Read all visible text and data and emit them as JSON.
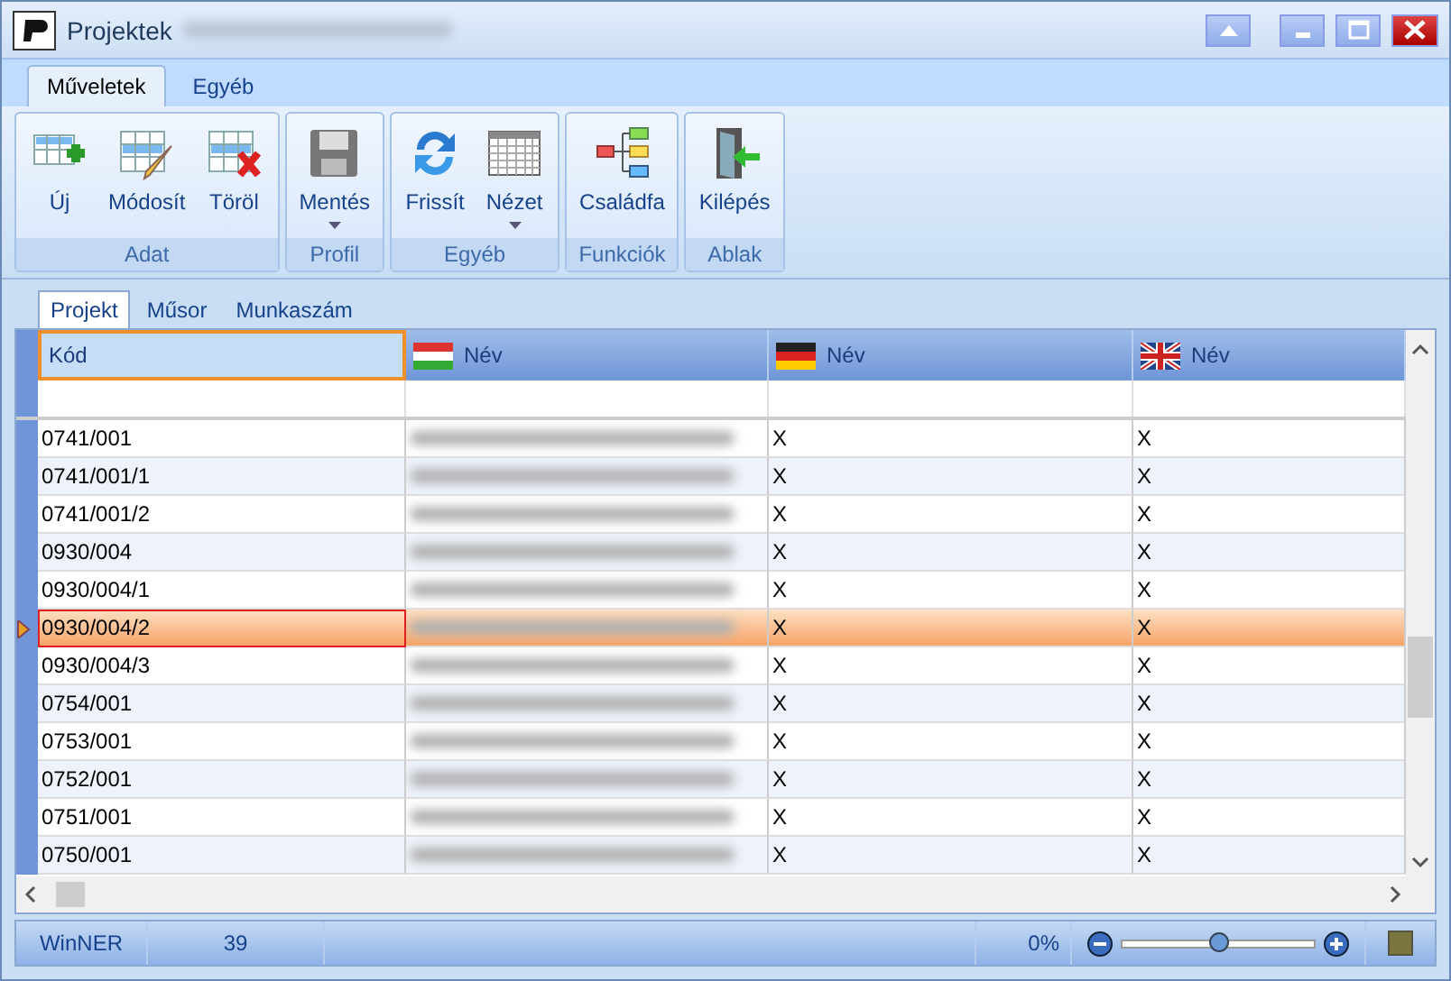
{
  "window": {
    "title": "Projektek"
  },
  "ribbon_tabs": [
    {
      "label": "Műveletek",
      "selected": true
    },
    {
      "label": "Egyéb",
      "selected": false
    }
  ],
  "ribbon_groups": [
    {
      "label": "Adat",
      "buttons": [
        {
          "label": "Új",
          "kind": "new",
          "dropdown": false
        },
        {
          "label": "Módosít",
          "kind": "edit",
          "dropdown": false
        },
        {
          "label": "Töröl",
          "kind": "delete",
          "dropdown": false
        }
      ]
    },
    {
      "label": "Profil",
      "buttons": [
        {
          "label": "Mentés",
          "kind": "save",
          "dropdown": true
        }
      ]
    },
    {
      "label": "Egyéb",
      "buttons": [
        {
          "label": "Frissít",
          "kind": "refresh",
          "dropdown": false
        },
        {
          "label": "Nézet",
          "kind": "grid",
          "dropdown": true
        }
      ]
    },
    {
      "label": "Funkciók",
      "buttons": [
        {
          "label": "Családfa",
          "kind": "tree",
          "dropdown": false
        }
      ]
    },
    {
      "label": "Ablak",
      "buttons": [
        {
          "label": "Kilépés",
          "kind": "exit",
          "dropdown": false
        }
      ]
    }
  ],
  "view_tabs": [
    {
      "label": "Projekt",
      "selected": true
    },
    {
      "label": "Műsor",
      "selected": false
    },
    {
      "label": "Munkaszám",
      "selected": false
    }
  ],
  "table": {
    "columns": [
      {
        "label": "Kód",
        "kind": "plain"
      },
      {
        "label": "Név",
        "kind": "hu"
      },
      {
        "label": "Név",
        "kind": "de"
      },
      {
        "label": "Név",
        "kind": "gb"
      }
    ],
    "rows": [
      {
        "code": "0741/001",
        "de": "X",
        "en": "X",
        "selected": false
      },
      {
        "code": "0741/001/1",
        "de": "X",
        "en": "X",
        "selected": false
      },
      {
        "code": "0741/001/2",
        "de": "X",
        "en": "X",
        "selected": false
      },
      {
        "code": "0930/004",
        "de": "X",
        "en": "X",
        "selected": false
      },
      {
        "code": "0930/004/1",
        "de": "X",
        "en": "X",
        "selected": false
      },
      {
        "code": "0930/004/2",
        "de": "X",
        "en": "X",
        "selected": true
      },
      {
        "code": "0930/004/3",
        "de": "X",
        "en": "X",
        "selected": false
      },
      {
        "code": "0754/001",
        "de": "X",
        "en": "X",
        "selected": false
      },
      {
        "code": "0753/001",
        "de": "X",
        "en": "X",
        "selected": false
      },
      {
        "code": "0752/001",
        "de": "X",
        "en": "X",
        "selected": false
      },
      {
        "code": "0751/001",
        "de": "X",
        "en": "X",
        "selected": false
      },
      {
        "code": "0750/001",
        "de": "X",
        "en": "X",
        "selected": false
      }
    ]
  },
  "status_bar": {
    "app": "WinNER",
    "count": "39",
    "percent": "0%",
    "zoom": {
      "level": 0.5
    }
  }
}
